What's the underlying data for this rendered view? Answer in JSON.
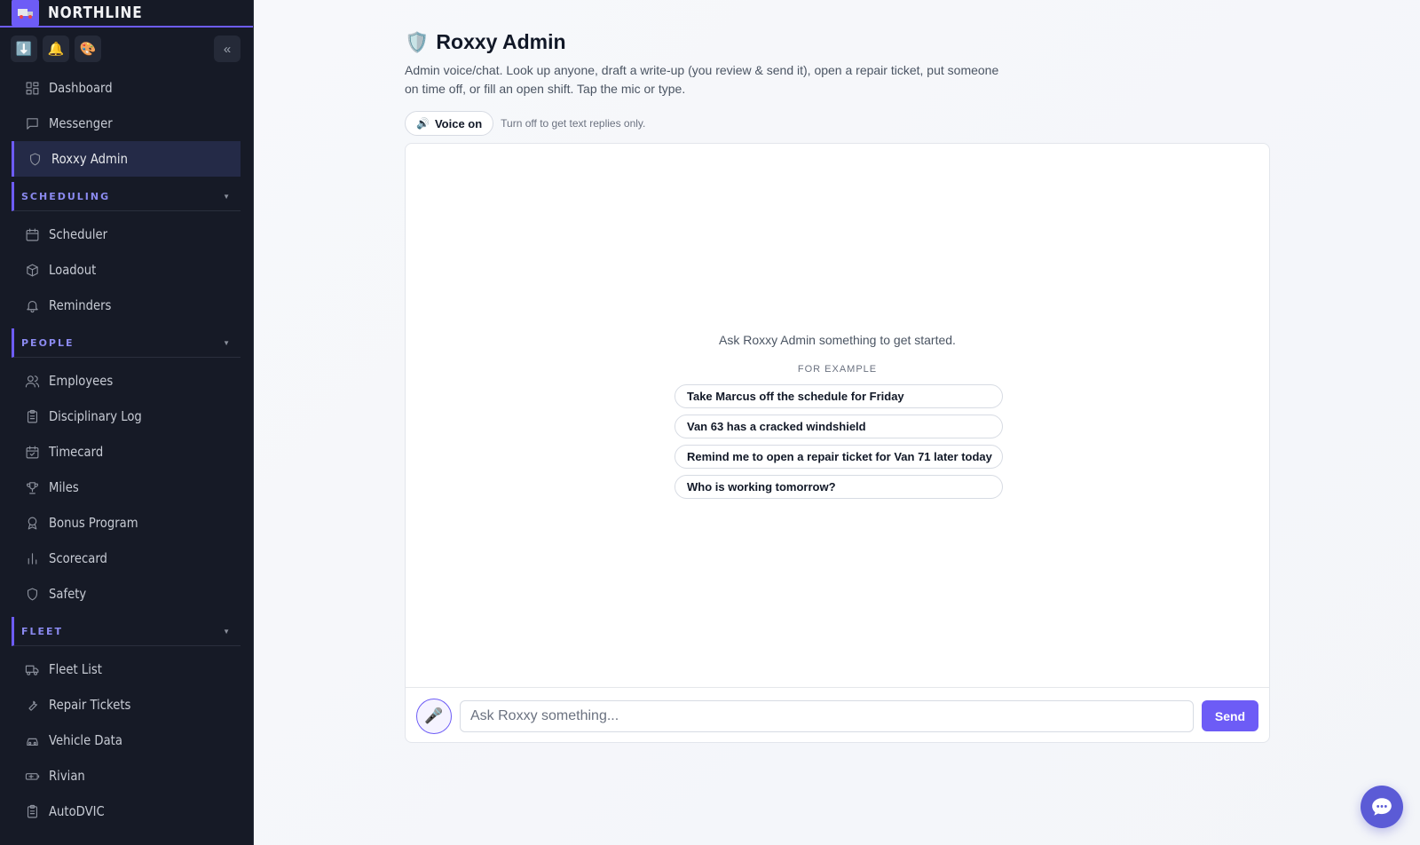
{
  "brand": {
    "name": "NORTHLINE",
    "logo_icon": "truck-icon"
  },
  "toolbar": {
    "download_icon": "⬇️",
    "bell_icon": "🔔",
    "palette_icon": "🎨",
    "collapse_label": "«"
  },
  "sidebar": {
    "top_items": [
      {
        "label": "Dashboard",
        "icon": "dashboard-icon"
      },
      {
        "label": "Messenger",
        "icon": "message-icon"
      },
      {
        "label": "Roxxy Admin",
        "icon": "shield-icon",
        "active": true
      }
    ],
    "sections": [
      {
        "title": "SCHEDULING",
        "items": [
          {
            "label": "Scheduler",
            "icon": "calendar-icon"
          },
          {
            "label": "Loadout",
            "icon": "box-icon"
          },
          {
            "label": "Reminders",
            "icon": "bell-icon"
          }
        ]
      },
      {
        "title": "PEOPLE",
        "items": [
          {
            "label": "Employees",
            "icon": "users-icon"
          },
          {
            "label": "Disciplinary Log",
            "icon": "clipboard-icon"
          },
          {
            "label": "Timecard",
            "icon": "calendar-check-icon"
          },
          {
            "label": "Miles",
            "icon": "trophy-icon"
          },
          {
            "label": "Bonus Program",
            "icon": "award-icon"
          },
          {
            "label": "Scorecard",
            "icon": "bar-chart-icon"
          },
          {
            "label": "Safety",
            "icon": "shield-icon"
          }
        ]
      },
      {
        "title": "FLEET",
        "items": [
          {
            "label": "Fleet List",
            "icon": "truck-icon"
          },
          {
            "label": "Repair Tickets",
            "icon": "wrench-icon"
          },
          {
            "label": "Vehicle Data",
            "icon": "car-icon"
          },
          {
            "label": "Rivian",
            "icon": "battery-icon"
          },
          {
            "label": "AutoDVIC",
            "icon": "clipboard-icon"
          }
        ]
      }
    ],
    "caret": "▼"
  },
  "main": {
    "title_icon": "🛡️",
    "title": "Roxxy Admin",
    "description": "Admin voice/chat. Look up anyone, draft a write-up (you review & send it), open a repair ticket, put someone on time off, or fill an open shift. Tap the mic or type.",
    "voice_icon": "🔊",
    "voice_label": "Voice on",
    "voice_hint": "Turn off to get text replies only.",
    "empty_message": "Ask Roxxy Admin something to get started.",
    "examples_title": "FOR EXAMPLE",
    "examples": [
      "Take Marcus off the schedule for Friday",
      "Van 63 has a cracked windshield",
      "Remind me to open a repair ticket for Van 71 later today",
      "Who is working tomorrow?"
    ],
    "mic_icon": "🎤",
    "input_placeholder": "Ask Roxxy something...",
    "input_value": "",
    "send_label": "Send"
  },
  "fab_icon": "chat-bubble-icon",
  "colors": {
    "accent": "#6d5cf6",
    "sidebar_bg": "#161a26",
    "fab": "#5b5bd6"
  }
}
